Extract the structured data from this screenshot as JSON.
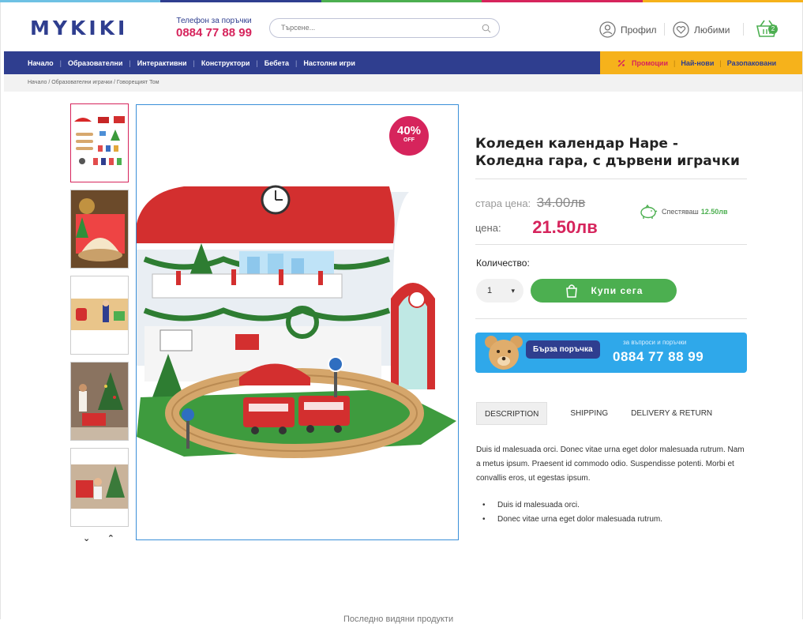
{
  "brand": {
    "logo": "MYKIKI",
    "stripe_colors": [
      "#6ec1e4",
      "#2f3e8f",
      "#4caf50",
      "#d6245c",
      "#f6b21b"
    ],
    "accent": "#d6245c",
    "navy": "#2f3e8f",
    "green": "#4caf50",
    "yellow": "#f6b21b"
  },
  "header": {
    "phone_caption": "Телефон за поръчки",
    "phone_number": "0884 77 88 99",
    "search_placeholder": "Търсене...",
    "profile_label": "Профил",
    "favorites_label": "Любими",
    "cart_count": "2"
  },
  "nav": {
    "items": [
      "Начало",
      "Образователни",
      "Интерактивни",
      "Конструктори",
      "Бебета",
      "Настолни игри"
    ],
    "promo_items": [
      {
        "label": "Промоции",
        "color": "#d6245c"
      },
      {
        "label": "Най-нови",
        "color": "#2f3e8f"
      },
      {
        "label": "Разопаковани",
        "color": "#2f3e8f"
      }
    ]
  },
  "breadcrumb": "Начало / Образователни играчки / Говорещият Том",
  "gallery": {
    "thumb_count": 5,
    "active_index": 0,
    "discount_badge": {
      "percent": "40%",
      "text": "OFF"
    }
  },
  "product": {
    "title": "Коледен календар Hape - Коледна гара, с дървени играчки",
    "old_price_label": "стара цена:",
    "old_price": "34.00лв",
    "price_label": "цена:",
    "price": "21.50лв",
    "savings_label": "Спестяваш",
    "savings_value": "12.50лв",
    "quantity_label": "Количество:",
    "quantity_value": "1",
    "buy_button": "Купи сега"
  },
  "quick_order": {
    "button": "Бърза поръчка",
    "caption": "за въпроси и поръчки",
    "phone": "0884 77 88 99"
  },
  "tabs": [
    {
      "label": "DESCRIPTION",
      "active": true
    },
    {
      "label": "SHIPPING",
      "active": false
    },
    {
      "label": "DELIVERY & RETURN",
      "active": false
    }
  ],
  "description": {
    "paragraph": "Duis id malesuada orci. Donec vitae urna eget dolor malesuada rutrum. Nam a metus ipsum. Praesent id commodo odio. Suspendisse potenti. Morbi et convallis eros, ut egestas ipsum.",
    "bullets": [
      "Duis id malesuada orci.",
      "Donec vitae urna eget dolor malesuada rutrum."
    ]
  },
  "footer_hint": "Последно видяни продукти"
}
